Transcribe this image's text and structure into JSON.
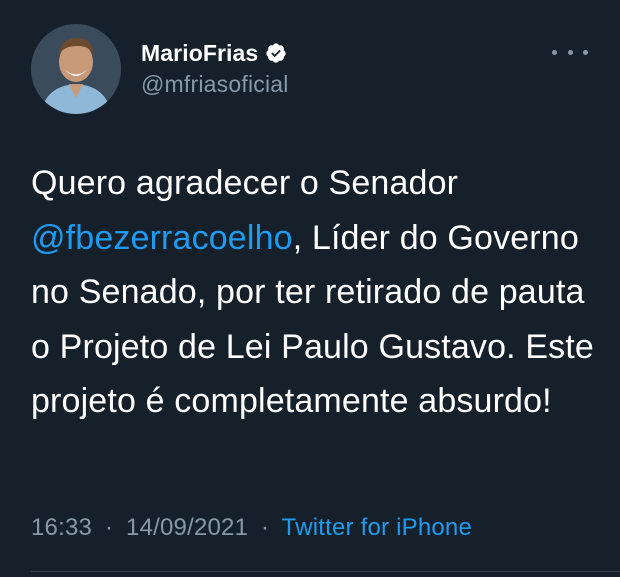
{
  "author": {
    "display_name": "MarioFrias",
    "handle": "@mfriasoficial",
    "verified": true,
    "avatar_icon": "profile-photo"
  },
  "more_menu_icon": "more-horizontal-icon",
  "tweet": {
    "text_segments": [
      {
        "text": "Quero agradecer o Senador ",
        "type": "text"
      },
      {
        "text": "@fbezerracoelho",
        "type": "mention"
      },
      {
        "text": ", Líder do Governo no Senado, por ter retirado de pauta o Projeto de Lei Paulo Gustavo. Este projeto é completamente absurdo!",
        "type": "text"
      }
    ],
    "time": "16:33",
    "date": "14/09/2021",
    "separator": "·",
    "source": "Twitter for iPhone"
  },
  "colors": {
    "background": "#15202b",
    "text": "#ffffff",
    "secondary": "#8899a6",
    "link": "#1d9bf0"
  }
}
